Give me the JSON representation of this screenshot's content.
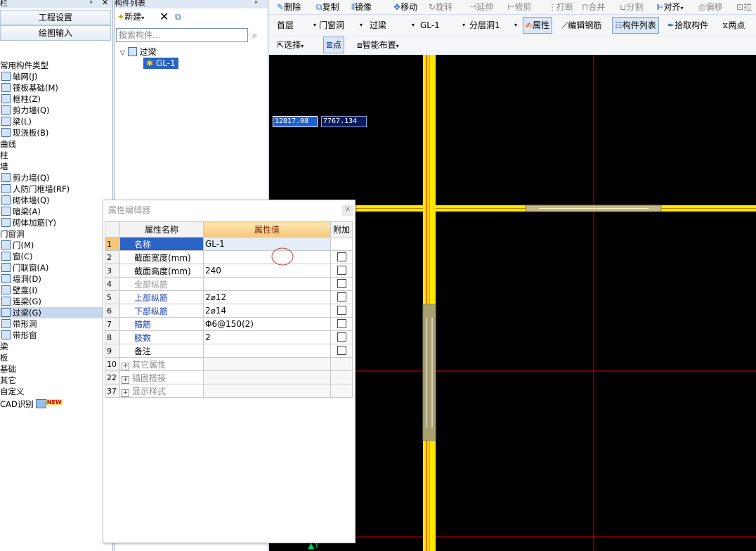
{
  "left_nav": {
    "header": "栏",
    "btn_project_settings": "工程设置",
    "btn_drawing_input": "绘图输入",
    "tree": [
      {
        "label": "常用构件类型",
        "level": 0,
        "icon": ""
      },
      {
        "label": "轴网(J)",
        "level": 1,
        "icon": "grid-icon"
      },
      {
        "label": "筏板基础(M)",
        "level": 1,
        "icon": "raft-icon"
      },
      {
        "label": "框柱(Z)",
        "level": 1,
        "icon": "column-icon"
      },
      {
        "label": "剪力墙(Q)",
        "level": 1,
        "icon": "wall-icon"
      },
      {
        "label": "梁(L)",
        "level": 1,
        "icon": "beam-icon"
      },
      {
        "label": "现浇板(B)",
        "level": 1,
        "icon": "slab-icon"
      },
      {
        "label": "曲线",
        "level": 0,
        "icon": ""
      },
      {
        "label": "柱",
        "level": 0,
        "icon": ""
      },
      {
        "label": "墙",
        "level": 0,
        "icon": ""
      },
      {
        "label": "剪力墙(Q)",
        "level": 1,
        "icon": "wall-icon"
      },
      {
        "label": "人防门框墙(RF)",
        "level": 1,
        "icon": "door-frame-icon"
      },
      {
        "label": "砌体墙(Q)",
        "level": 1,
        "icon": "masonry-icon"
      },
      {
        "label": "暗梁(A)",
        "level": 1,
        "icon": "hidden-beam-icon"
      },
      {
        "label": "砌体加筋(Y)",
        "level": 1,
        "icon": "rebar-icon"
      },
      {
        "label": "门窗洞",
        "level": 0,
        "icon": ""
      },
      {
        "label": "门(M)",
        "level": 1,
        "icon": "door-icon"
      },
      {
        "label": "窗(C)",
        "level": 1,
        "icon": "window-icon"
      },
      {
        "label": "门联窗(A)",
        "level": 1,
        "icon": "door-window-icon"
      },
      {
        "label": "墙洞(D)",
        "level": 1,
        "icon": "wall-hole-icon"
      },
      {
        "label": "壁龛(I)",
        "level": 1,
        "icon": "niche-icon"
      },
      {
        "label": "连梁(G)",
        "level": 1,
        "icon": "link-beam-icon"
      },
      {
        "label": "过梁(G)",
        "level": 1,
        "icon": "lintel-icon",
        "selected": true
      },
      {
        "label": "带形洞",
        "level": 1,
        "icon": "strip-hole-icon"
      },
      {
        "label": "带形窗",
        "level": 1,
        "icon": "strip-window-icon"
      },
      {
        "label": "梁",
        "level": 0,
        "icon": ""
      },
      {
        "label": "板",
        "level": 0,
        "icon": ""
      },
      {
        "label": "基础",
        "level": 0,
        "icon": ""
      },
      {
        "label": "其它",
        "level": 0,
        "icon": ""
      },
      {
        "label": "自定义",
        "level": 0,
        "icon": ""
      },
      {
        "label": "CAD识别",
        "level": 0,
        "icon": "cad-icon",
        "badge": "NEW"
      }
    ]
  },
  "component_list": {
    "header": "构件列表",
    "new_label": "新建",
    "search_placeholder": "搜索构件...",
    "tree_root": "过梁",
    "tree_child": "GL-1"
  },
  "toolbar1": {
    "delete": "删除",
    "copy": "复制",
    "mirror": "镜像",
    "move": "移动",
    "rotate": "旋转",
    "extend": "延伸",
    "trim": "修剪",
    "break": "打断",
    "merge": "合并",
    "split": "分割",
    "align": "对齐",
    "offset": "偏移",
    "stretch": "拉"
  },
  "toolbar2": {
    "floor": "首层",
    "category": "门窗洞",
    "type": "过梁",
    "component": "GL-1",
    "layer": "分层洞1",
    "properties": "属性",
    "edit_rebar": "编辑钢筋",
    "component_list": "构件列表",
    "pick": "拾取构件",
    "two_points": "两点"
  },
  "toolbar3": {
    "select": "选择",
    "point": "点",
    "smart_layout": "智能布置"
  },
  "canvas": {
    "coord_x": "12817.08",
    "coord_y": "7767.134"
  },
  "property_editor": {
    "title": "属性编辑器",
    "col_name": "属性名称",
    "col_value": "属性值",
    "col_extra": "附加",
    "rows": [
      {
        "no": "1",
        "name": "名称",
        "value": "GL-1",
        "style": "blue",
        "checkbox": false
      },
      {
        "no": "2",
        "name": "截面宽度(mm)",
        "value": "",
        "style": "normal",
        "checkbox": true
      },
      {
        "no": "3",
        "name": "截面高度(mm)",
        "value": "240",
        "style": "normal",
        "checkbox": true
      },
      {
        "no": "4",
        "name": "全部纵筋",
        "value": "",
        "style": "gray",
        "checkbox": true
      },
      {
        "no": "5",
        "name": "上部纵筋",
        "value": "2⌀12",
        "style": "blue",
        "checkbox": true
      },
      {
        "no": "6",
        "name": "下部纵筋",
        "value": "2⌀14",
        "style": "blue",
        "checkbox": true
      },
      {
        "no": "7",
        "name": "箍筋",
        "value": "Φ6@150(2)",
        "style": "blue",
        "checkbox": true
      },
      {
        "no": "8",
        "name": "肢数",
        "value": "2",
        "style": "blue",
        "checkbox": true
      },
      {
        "no": "9",
        "name": "备注",
        "value": "",
        "style": "normal",
        "checkbox": true
      },
      {
        "no": "10",
        "name": "其它属性",
        "value": "",
        "style": "group",
        "checkbox": false
      },
      {
        "no": "22",
        "name": "锚固搭接",
        "value": "",
        "style": "group",
        "checkbox": false
      },
      {
        "no": "37",
        "name": "显示样式",
        "value": "",
        "style": "group",
        "checkbox": false
      }
    ]
  }
}
